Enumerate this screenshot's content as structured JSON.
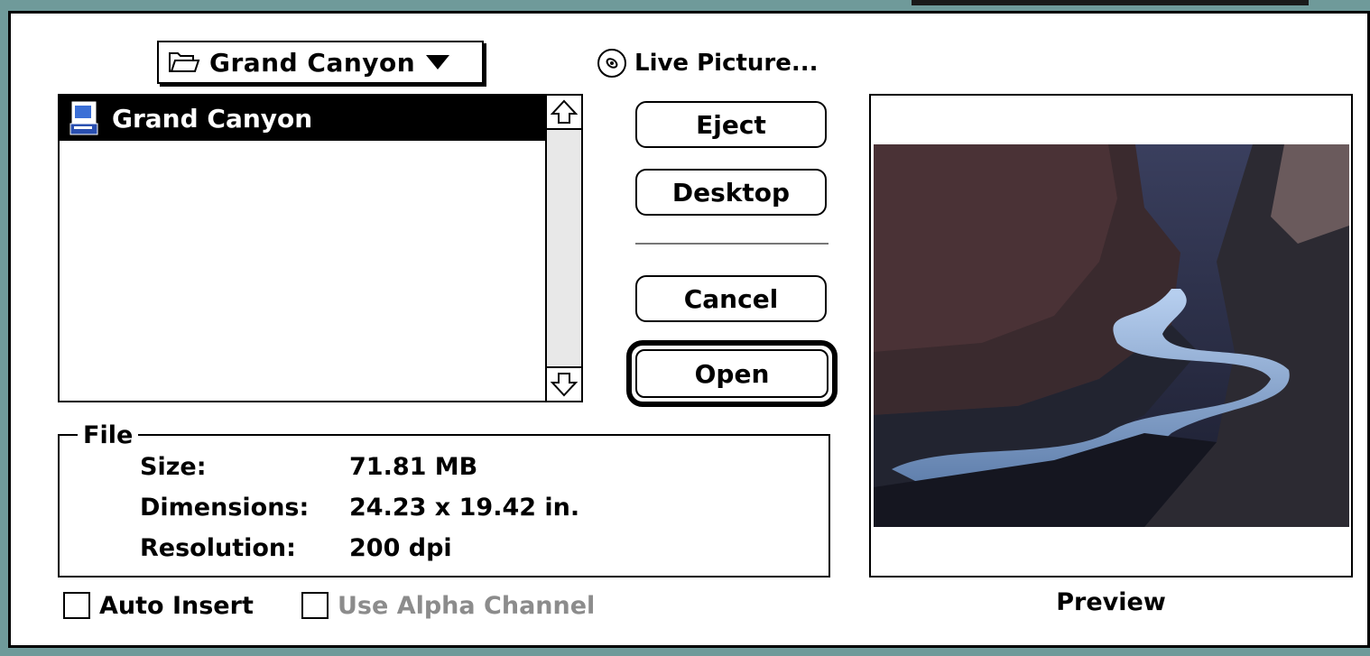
{
  "dialog": {
    "folder_popup": {
      "label": "Grand Canyon",
      "icon": "folder-icon"
    },
    "disk_button": {
      "label": "Live Picture...",
      "icon": "disk-icon"
    },
    "file_list": {
      "items": [
        {
          "label": "Grand Canyon",
          "icon": "document-icon",
          "selected": true
        }
      ]
    },
    "buttons": {
      "eject": "Eject",
      "desktop": "Desktop",
      "cancel": "Cancel",
      "open": "Open"
    },
    "file_info": {
      "title": "File",
      "size_label": "Size:",
      "size_value": "71.81 MB",
      "dimensions_label": "Dimensions:",
      "dimensions_value": "24.23 x 19.42 in.",
      "resolution_label": "Resolution:",
      "resolution_value": "200 dpi"
    },
    "options": {
      "auto_insert": {
        "label": "Auto Insert",
        "checked": false,
        "enabled": true
      },
      "use_alpha": {
        "label": "Use Alpha Channel",
        "checked": false,
        "enabled": false
      }
    },
    "preview": {
      "caption": "Preview"
    }
  },
  "colors": {
    "window_frame": "#6f9a9a",
    "selection": "#000000",
    "disabled_text": "#8c8c8c"
  }
}
